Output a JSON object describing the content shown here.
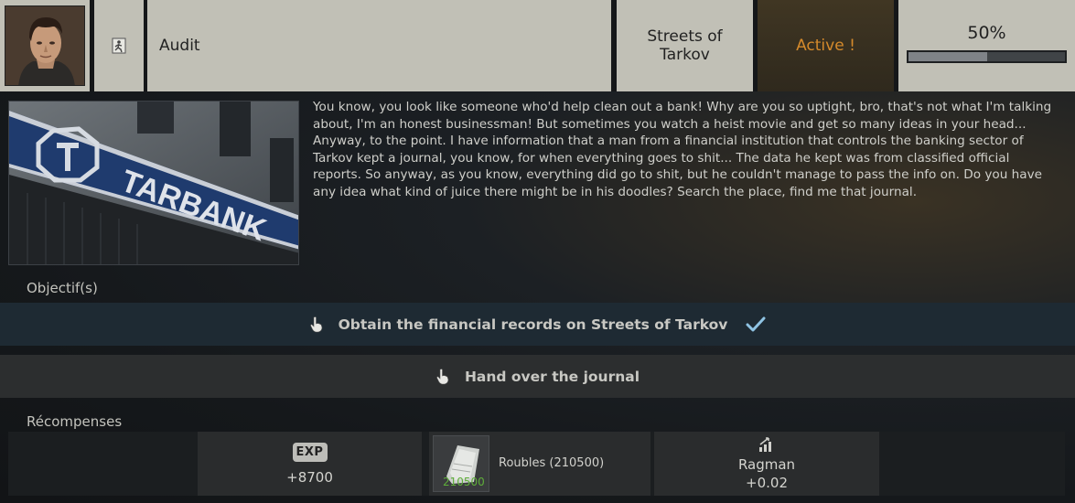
{
  "quest": {
    "title": "Audit",
    "location": "Streets of Tarkov",
    "status": "Active !",
    "progress_label": "50%",
    "progress_fraction": 0.5,
    "image_sign": "TARBANK",
    "description": "You know, you look like someone who'd help clean out a bank! Why are you so uptight, bro, that's not what I'm talking about, I'm an honest businessman! But sometimes you watch a heist movie and get so many ideas in your head... Anyway, to the point. I have information that a man from a financial institution that controls the banking sector of Tarkov kept a journal, you know, for when everything goes to shit... The data he kept was from classified official reports. So anyway, as you know, everything did go to shit, but he couldn't manage to pass the info on. Do you have any idea what kind of juice there might be in his doodles? Search the place, find me that journal."
  },
  "objectives": {
    "label": "Objectif(s)",
    "items": [
      {
        "text": "Obtain the financial records on Streets of Tarkov",
        "completed": true
      },
      {
        "text": "Hand over the journal",
        "completed": false
      }
    ]
  },
  "rewards": {
    "label": "Récompenses",
    "exp": {
      "badge": "EXP",
      "value": "+8700"
    },
    "money": {
      "label": "Roubles (210500)",
      "count": "210500"
    },
    "trader": {
      "name": "Ragman",
      "value": "+0.02"
    }
  },
  "icons": {
    "exit": "exit-door-icon",
    "hand": "pointing-hand-icon",
    "check": "checkmark-icon",
    "trader": "trader-standing-icon"
  },
  "colors": {
    "header_bg": "#c1c0b6",
    "status_text": "#d58a2b",
    "objective_done_bg": "#1e2a33",
    "checkmark": "#8fc3e3",
    "money_count": "#5fae3a"
  }
}
